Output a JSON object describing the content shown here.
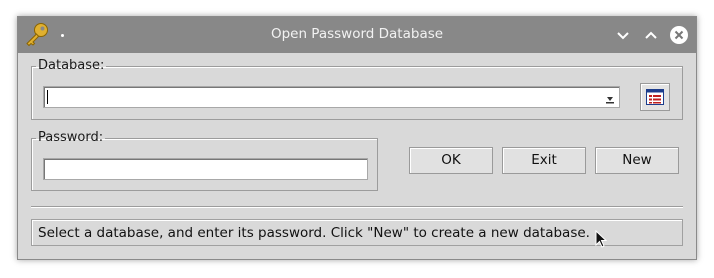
{
  "window": {
    "title": "Open Password Database",
    "icon": "key-icon",
    "titlebar_buttons": [
      "minimize-icon",
      "maximize-icon",
      "close-icon"
    ]
  },
  "database": {
    "label": "Database:",
    "value": "",
    "browse_icon": "file-browse-icon"
  },
  "password": {
    "label": "Password:",
    "value": ""
  },
  "buttons": {
    "ok": "OK",
    "exit": "Exit",
    "new": "New"
  },
  "status": {
    "text": "Select a database, and enter its password. Click \"New\" to create a new database."
  },
  "colors": {
    "titlebar": "#888888",
    "window_bg": "#d9d9d9",
    "key_gold": "#d9a520"
  }
}
